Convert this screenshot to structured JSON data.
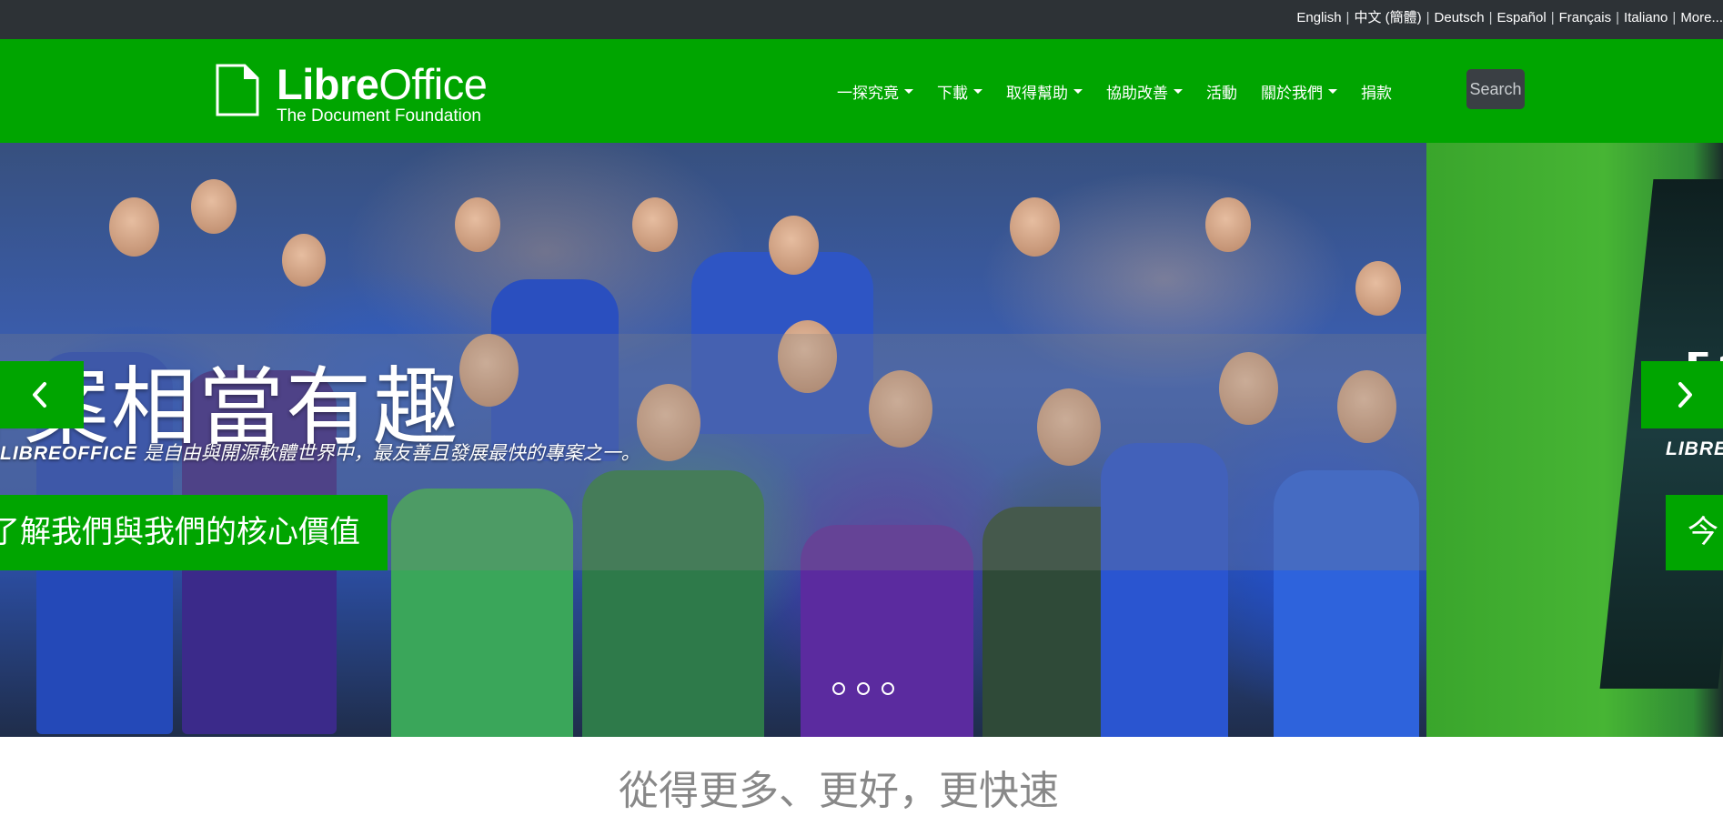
{
  "languages": [
    {
      "label": "English"
    },
    {
      "label": "中文 (簡體)"
    },
    {
      "label": "Deutsch"
    },
    {
      "label": "Español"
    },
    {
      "label": "Français"
    },
    {
      "label": "Italiano"
    },
    {
      "label": "More..."
    }
  ],
  "header": {
    "logo_title_bold": "Libre",
    "logo_title_rest": "Office",
    "logo_subtitle": "The Document Foundation",
    "nav": [
      {
        "label": "一探究竟",
        "dropdown": true
      },
      {
        "label": "下載",
        "dropdown": true
      },
      {
        "label": "取得幫助",
        "dropdown": true
      },
      {
        "label": "協助改善",
        "dropdown": true
      },
      {
        "label": "活動",
        "dropdown": false
      },
      {
        "label": "關於我們",
        "dropdown": true
      },
      {
        "label": "捐款",
        "dropdown": false
      }
    ],
    "search_label": "Search"
  },
  "hero": {
    "title": "專案相當有趣",
    "subtitle_brand": "LIBREOFFICE",
    "subtitle_text": " 是自由與開源軟體世界中，最友善且發展最快的專案之一。",
    "cta_label": "了解我們與我們的核心價值",
    "next_title_fragment": "[?",
    "next_caption_fragment": "LIBRE",
    "next_cta_fragment": "今",
    "slide_count": 3,
    "active_slide": 1
  },
  "below": {
    "heading_fragment": "從得更多、更好，更快速"
  },
  "colors": {
    "brand_green": "#00a500",
    "topbar": "#2d3236",
    "search_bg": "#3a3f44"
  }
}
